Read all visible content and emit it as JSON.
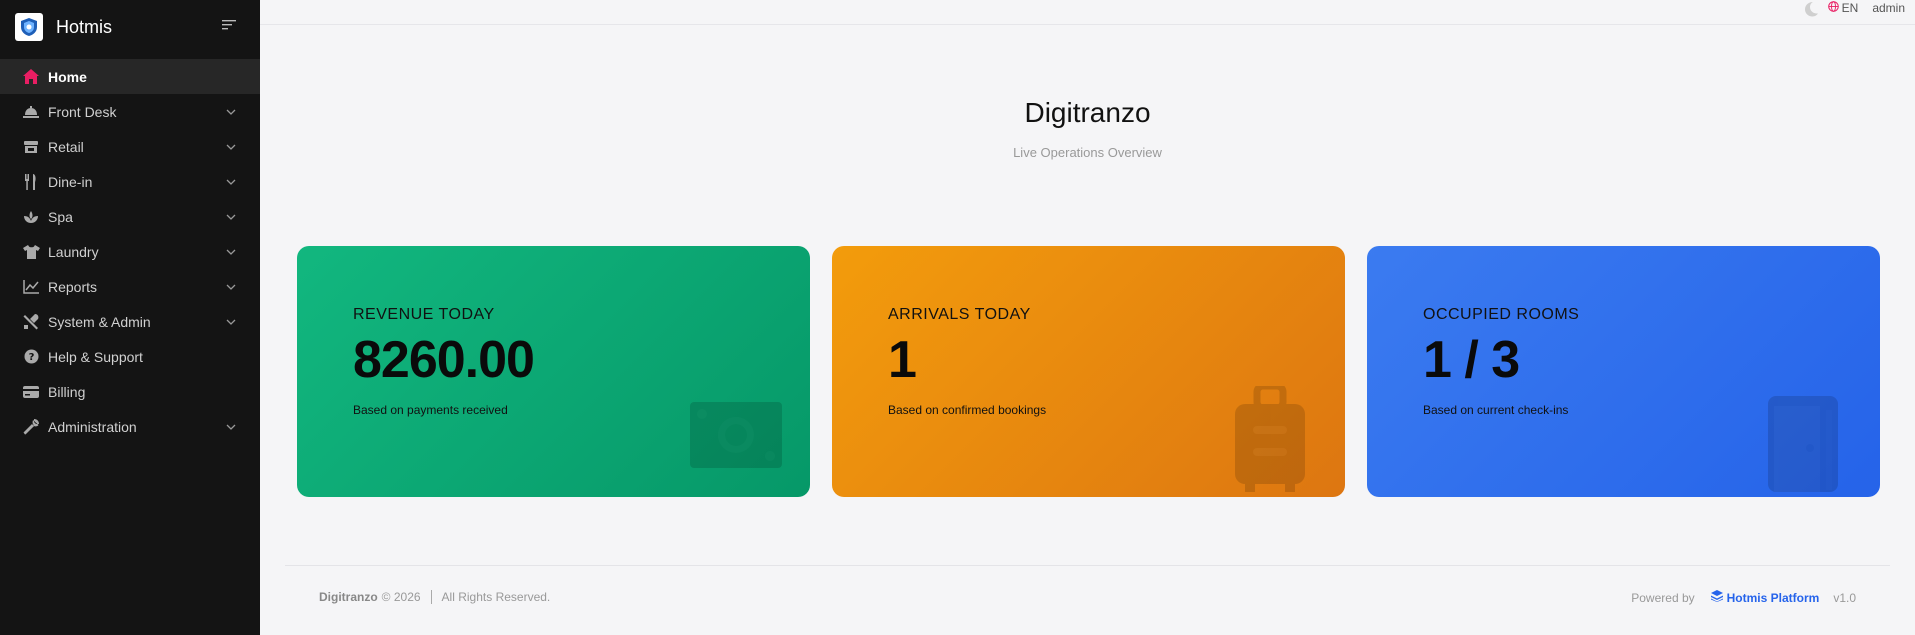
{
  "app": {
    "title": "Hotmis"
  },
  "sidebar": {
    "items": [
      {
        "label": "Home",
        "icon": "home-icon",
        "active": true,
        "expandable": false
      },
      {
        "label": "Front Desk",
        "icon": "bell-icon",
        "active": false,
        "expandable": true
      },
      {
        "label": "Retail",
        "icon": "store-icon",
        "active": false,
        "expandable": true
      },
      {
        "label": "Dine-in",
        "icon": "utensils-icon",
        "active": false,
        "expandable": true
      },
      {
        "label": "Spa",
        "icon": "spa-icon",
        "active": false,
        "expandable": true
      },
      {
        "label": "Laundry",
        "icon": "shirt-icon",
        "active": false,
        "expandable": true
      },
      {
        "label": "Reports",
        "icon": "chart-line-icon",
        "active": false,
        "expandable": true
      },
      {
        "label": "System & Admin",
        "icon": "tools-icon",
        "active": false,
        "expandable": true
      },
      {
        "label": "Help & Support",
        "icon": "question-icon",
        "active": false,
        "expandable": false
      },
      {
        "label": "Billing",
        "icon": "credit-card-icon",
        "active": false,
        "expandable": false
      },
      {
        "label": "Administration",
        "icon": "wrench-icon",
        "active": false,
        "expandable": true
      }
    ]
  },
  "topbar": {
    "language": "EN",
    "user": "admin"
  },
  "main": {
    "title": "Digitranzo",
    "subtitle": "Live Operations Overview",
    "cards": [
      {
        "label": "REVENUE TODAY",
        "value": "8260.00",
        "note": "Based on payments received",
        "icon": "money-bill-icon",
        "color": "#10b981"
      },
      {
        "label": "ARRIVALS TODAY",
        "value": "1",
        "note": "Based on confirmed bookings",
        "icon": "suitcase-icon",
        "color": "#f59e0b"
      },
      {
        "label": "OCCUPIED ROOMS",
        "value": "1 / 3",
        "note": "Based on current check-ins",
        "icon": "door-icon",
        "color": "#3b82f6"
      }
    ]
  },
  "footer": {
    "company": "Digitranzo",
    "copyright": "© 2026",
    "rights": "All Rights Reserved.",
    "powered_by": "Powered by",
    "platform": "Hotmis Platform",
    "version": "v1.0"
  },
  "colors": {
    "accent": "#e91e63",
    "sidebar_bg": "#141414",
    "link": "#2563eb"
  }
}
